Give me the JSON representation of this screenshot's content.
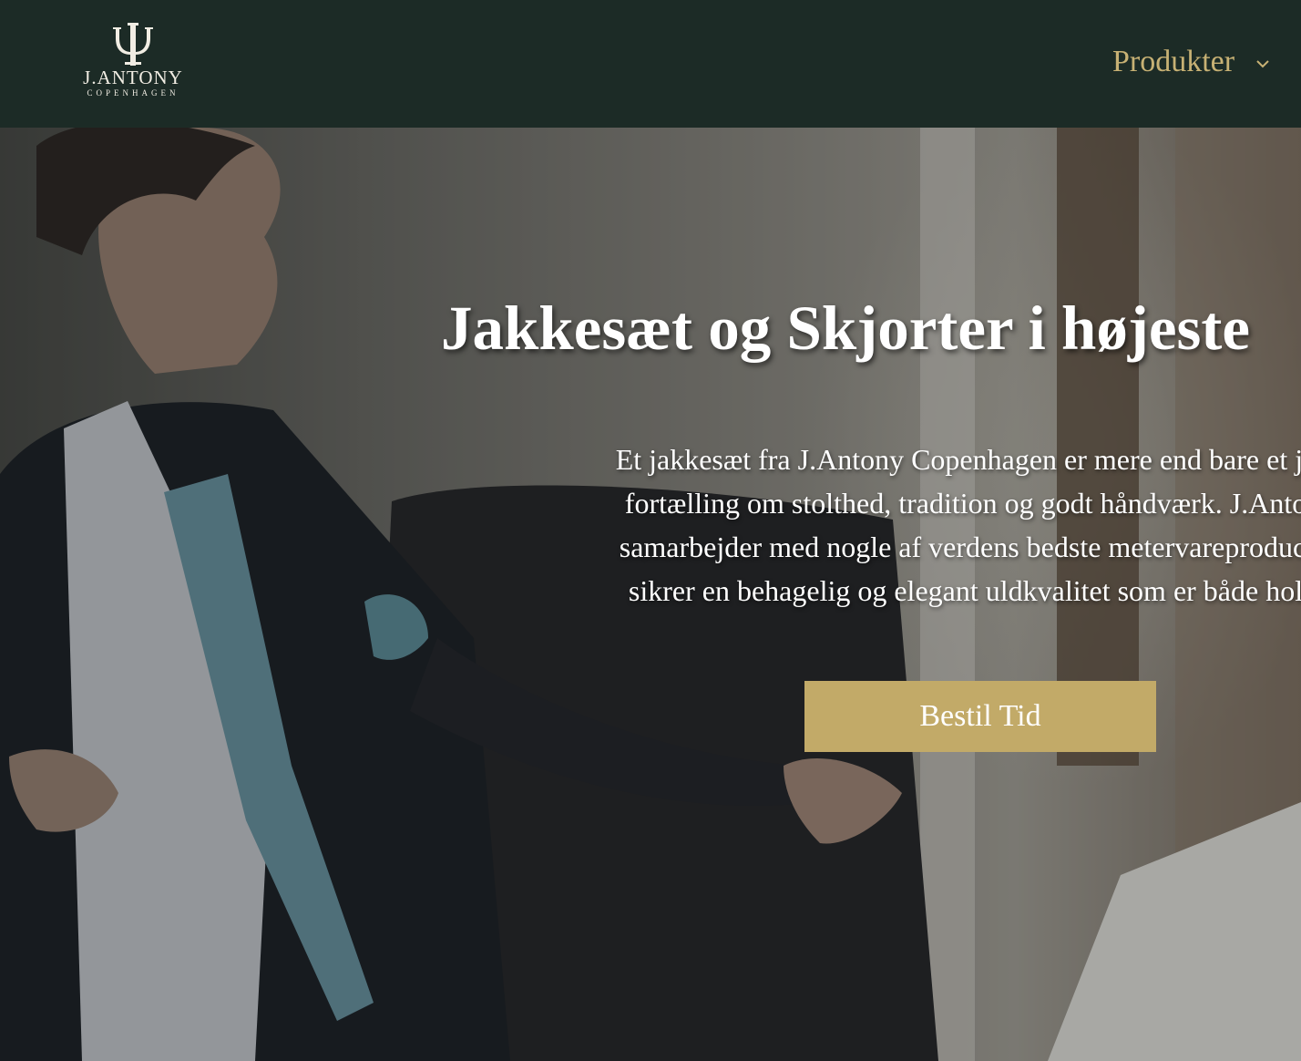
{
  "header": {
    "logo": {
      "name": "J.ANTONY",
      "sub": "COPENHAGEN"
    },
    "nav": {
      "products_label": "Produkter",
      "products_icon": "chevron-down-icon"
    }
  },
  "hero": {
    "title": "Jakkesæt og Skjorter i højeste",
    "text_lines": [
      "Et jakkesæt fra J.Antony Copenhagen er mere end bare et jakk",
      "fortælling om stolthed, tradition og godt håndværk. J.Antony",
      "samarbejder med nogle af verdens bedste metervareproducent",
      "sikrer en behagelig og elegant uldkvalitet som er både holdb"
    ],
    "cta_label": "Bestil Tid"
  },
  "colors": {
    "header_bg": "#1c2b26",
    "accent_gold": "#c2aa68",
    "nav_gold": "#c7b174"
  }
}
